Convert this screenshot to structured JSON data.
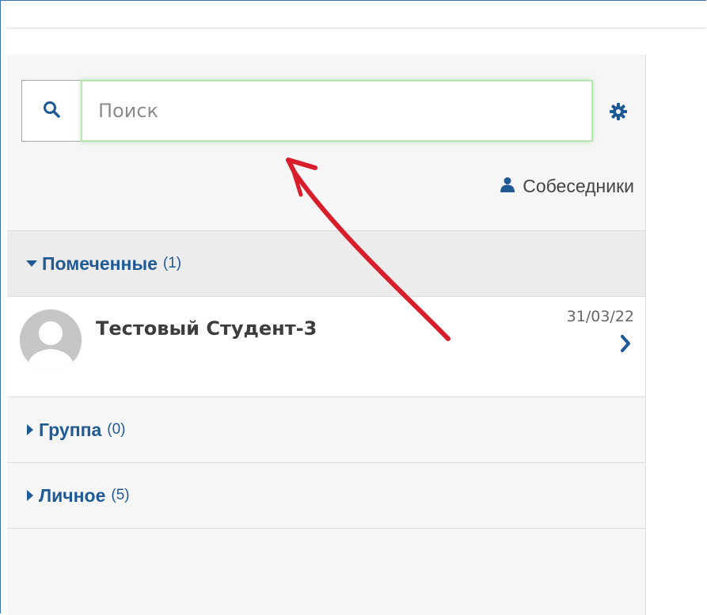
{
  "search": {
    "placeholder": "Поиск"
  },
  "settings": {
    "icon": "gear-icon"
  },
  "contacts": {
    "label": "Собеседники"
  },
  "sections": {
    "starred": {
      "title": "Помеченные",
      "count": "(1)"
    },
    "group": {
      "title": "Группа",
      "count": "(0)"
    },
    "private": {
      "title": "Личное",
      "count": "(5)"
    }
  },
  "conversations": [
    {
      "name": "Тестовый Студент-3",
      "date": "31/03/22"
    }
  ],
  "colors": {
    "accent": "#1f5a94",
    "search_focus_border": "#b7e6b3",
    "annotation": "#d81e2a"
  }
}
